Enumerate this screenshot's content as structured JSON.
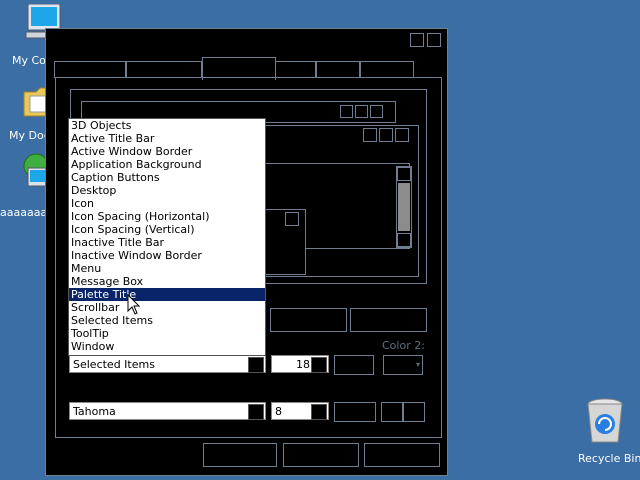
{
  "desktop": {
    "icons": [
      {
        "name": "my-computer",
        "label": "My Co"
      },
      {
        "name": "my-documents",
        "label": "My Doc"
      },
      {
        "name": "network",
        "label": "aaaaaaa"
      },
      {
        "name": "recycle-bin",
        "label": "Recycle Bin"
      }
    ]
  },
  "dialog": {
    "item_list": [
      "3D Objects",
      "Active Title Bar",
      "Active Window Border",
      "Application Background",
      "Caption Buttons",
      "Desktop",
      "Icon",
      "Icon Spacing (Horizontal)",
      "Icon Spacing (Vertical)",
      "Inactive Title Bar",
      "Inactive Window Border",
      "Menu",
      "Message Box",
      "Palette Title",
      "Scrollbar",
      "Selected Items",
      "ToolTip",
      "Window"
    ],
    "highlighted_index": 13,
    "item_select_value": "Selected Items",
    "size_value": "18",
    "color2_label": "Color 2:",
    "font_select_value": "Tahoma",
    "font_size_value": "8"
  },
  "colors": {
    "desktop": "#3a6ea5",
    "dialog_bg": "#000000",
    "border": "#6f7f8f",
    "selection": "#0a246a"
  }
}
